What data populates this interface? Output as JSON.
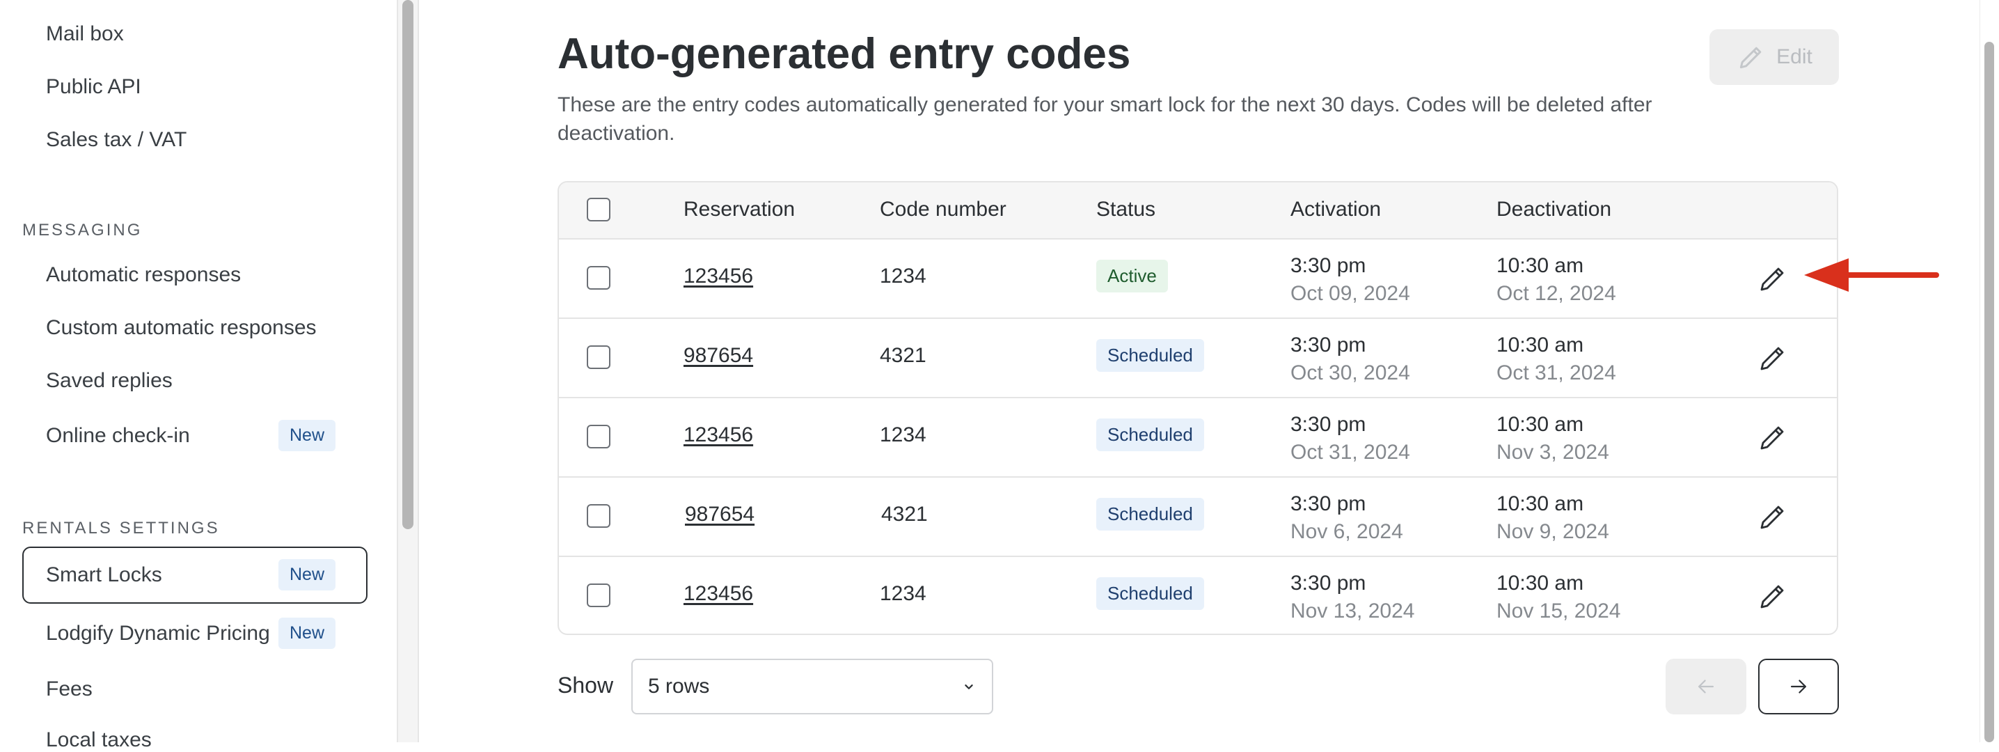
{
  "sidebar": {
    "items_top": [
      "Mail box",
      "Public API",
      "Sales tax / VAT"
    ],
    "section_messaging": "MESSAGING",
    "messaging_items": [
      "Automatic responses",
      "Custom automatic responses",
      "Saved replies"
    ],
    "online_checkin": {
      "label": "Online check-in",
      "badge": "New"
    },
    "section_rentals": "RENTALS SETTINGS",
    "smart_locks": {
      "label": "Smart Locks",
      "badge": "New"
    },
    "dynamic_pricing": {
      "label": "Lodgify Dynamic Pricing",
      "badge": "New"
    },
    "fees": "Fees",
    "local_taxes": "Local taxes"
  },
  "main": {
    "title": "Auto-generated entry codes",
    "description": "These are the entry codes automatically generated for your smart lock for the next 30 days. Codes will be deleted after deactivation.",
    "edit_label": "Edit",
    "table": {
      "headers": {
        "reservation": "Reservation",
        "code": "Code number",
        "status": "Status",
        "activation": "Activation",
        "deactivation": "Deactivation"
      },
      "rows": [
        {
          "reservation": "123456",
          "code": "1234",
          "status": "Active",
          "activation_time": "3:30 pm",
          "activation_date": "Oct 09, 2024",
          "deactivation_time": "10:30 am",
          "deactivation_date": "Oct 12, 2024"
        },
        {
          "reservation": "987654",
          "code": "4321",
          "status": "Scheduled",
          "activation_time": "3:30 pm",
          "activation_date": "Oct 30, 2024",
          "deactivation_time": "10:30 am",
          "deactivation_date": "Oct 31, 2024"
        },
        {
          "reservation": "123456",
          "code": "1234",
          "status": "Scheduled",
          "activation_time": "3:30 pm",
          "activation_date": "Oct 31, 2024",
          "deactivation_time": "10:30 am",
          "deactivation_date": "Nov 3, 2024"
        },
        {
          "reservation": "987654",
          "code": "4321",
          "status": "Scheduled",
          "activation_time": "3:30 pm",
          "activation_date": "Nov 6, 2024",
          "deactivation_time": "10:30 am",
          "deactivation_date": "Nov 9, 2024"
        },
        {
          "reservation": "123456",
          "code": "1234",
          "status": "Scheduled",
          "activation_time": "3:30 pm",
          "activation_date": "Nov 13, 2024",
          "deactivation_time": "10:30 am",
          "deactivation_date": "Nov 15, 2024"
        }
      ]
    },
    "pagination": {
      "show_label": "Show",
      "rows_value": "5 rows"
    }
  },
  "colors": {
    "annotation_arrow": "#d9301c",
    "active_badge_bg": "#e7f5ea",
    "scheduled_badge_bg": "#e8f1fb"
  }
}
